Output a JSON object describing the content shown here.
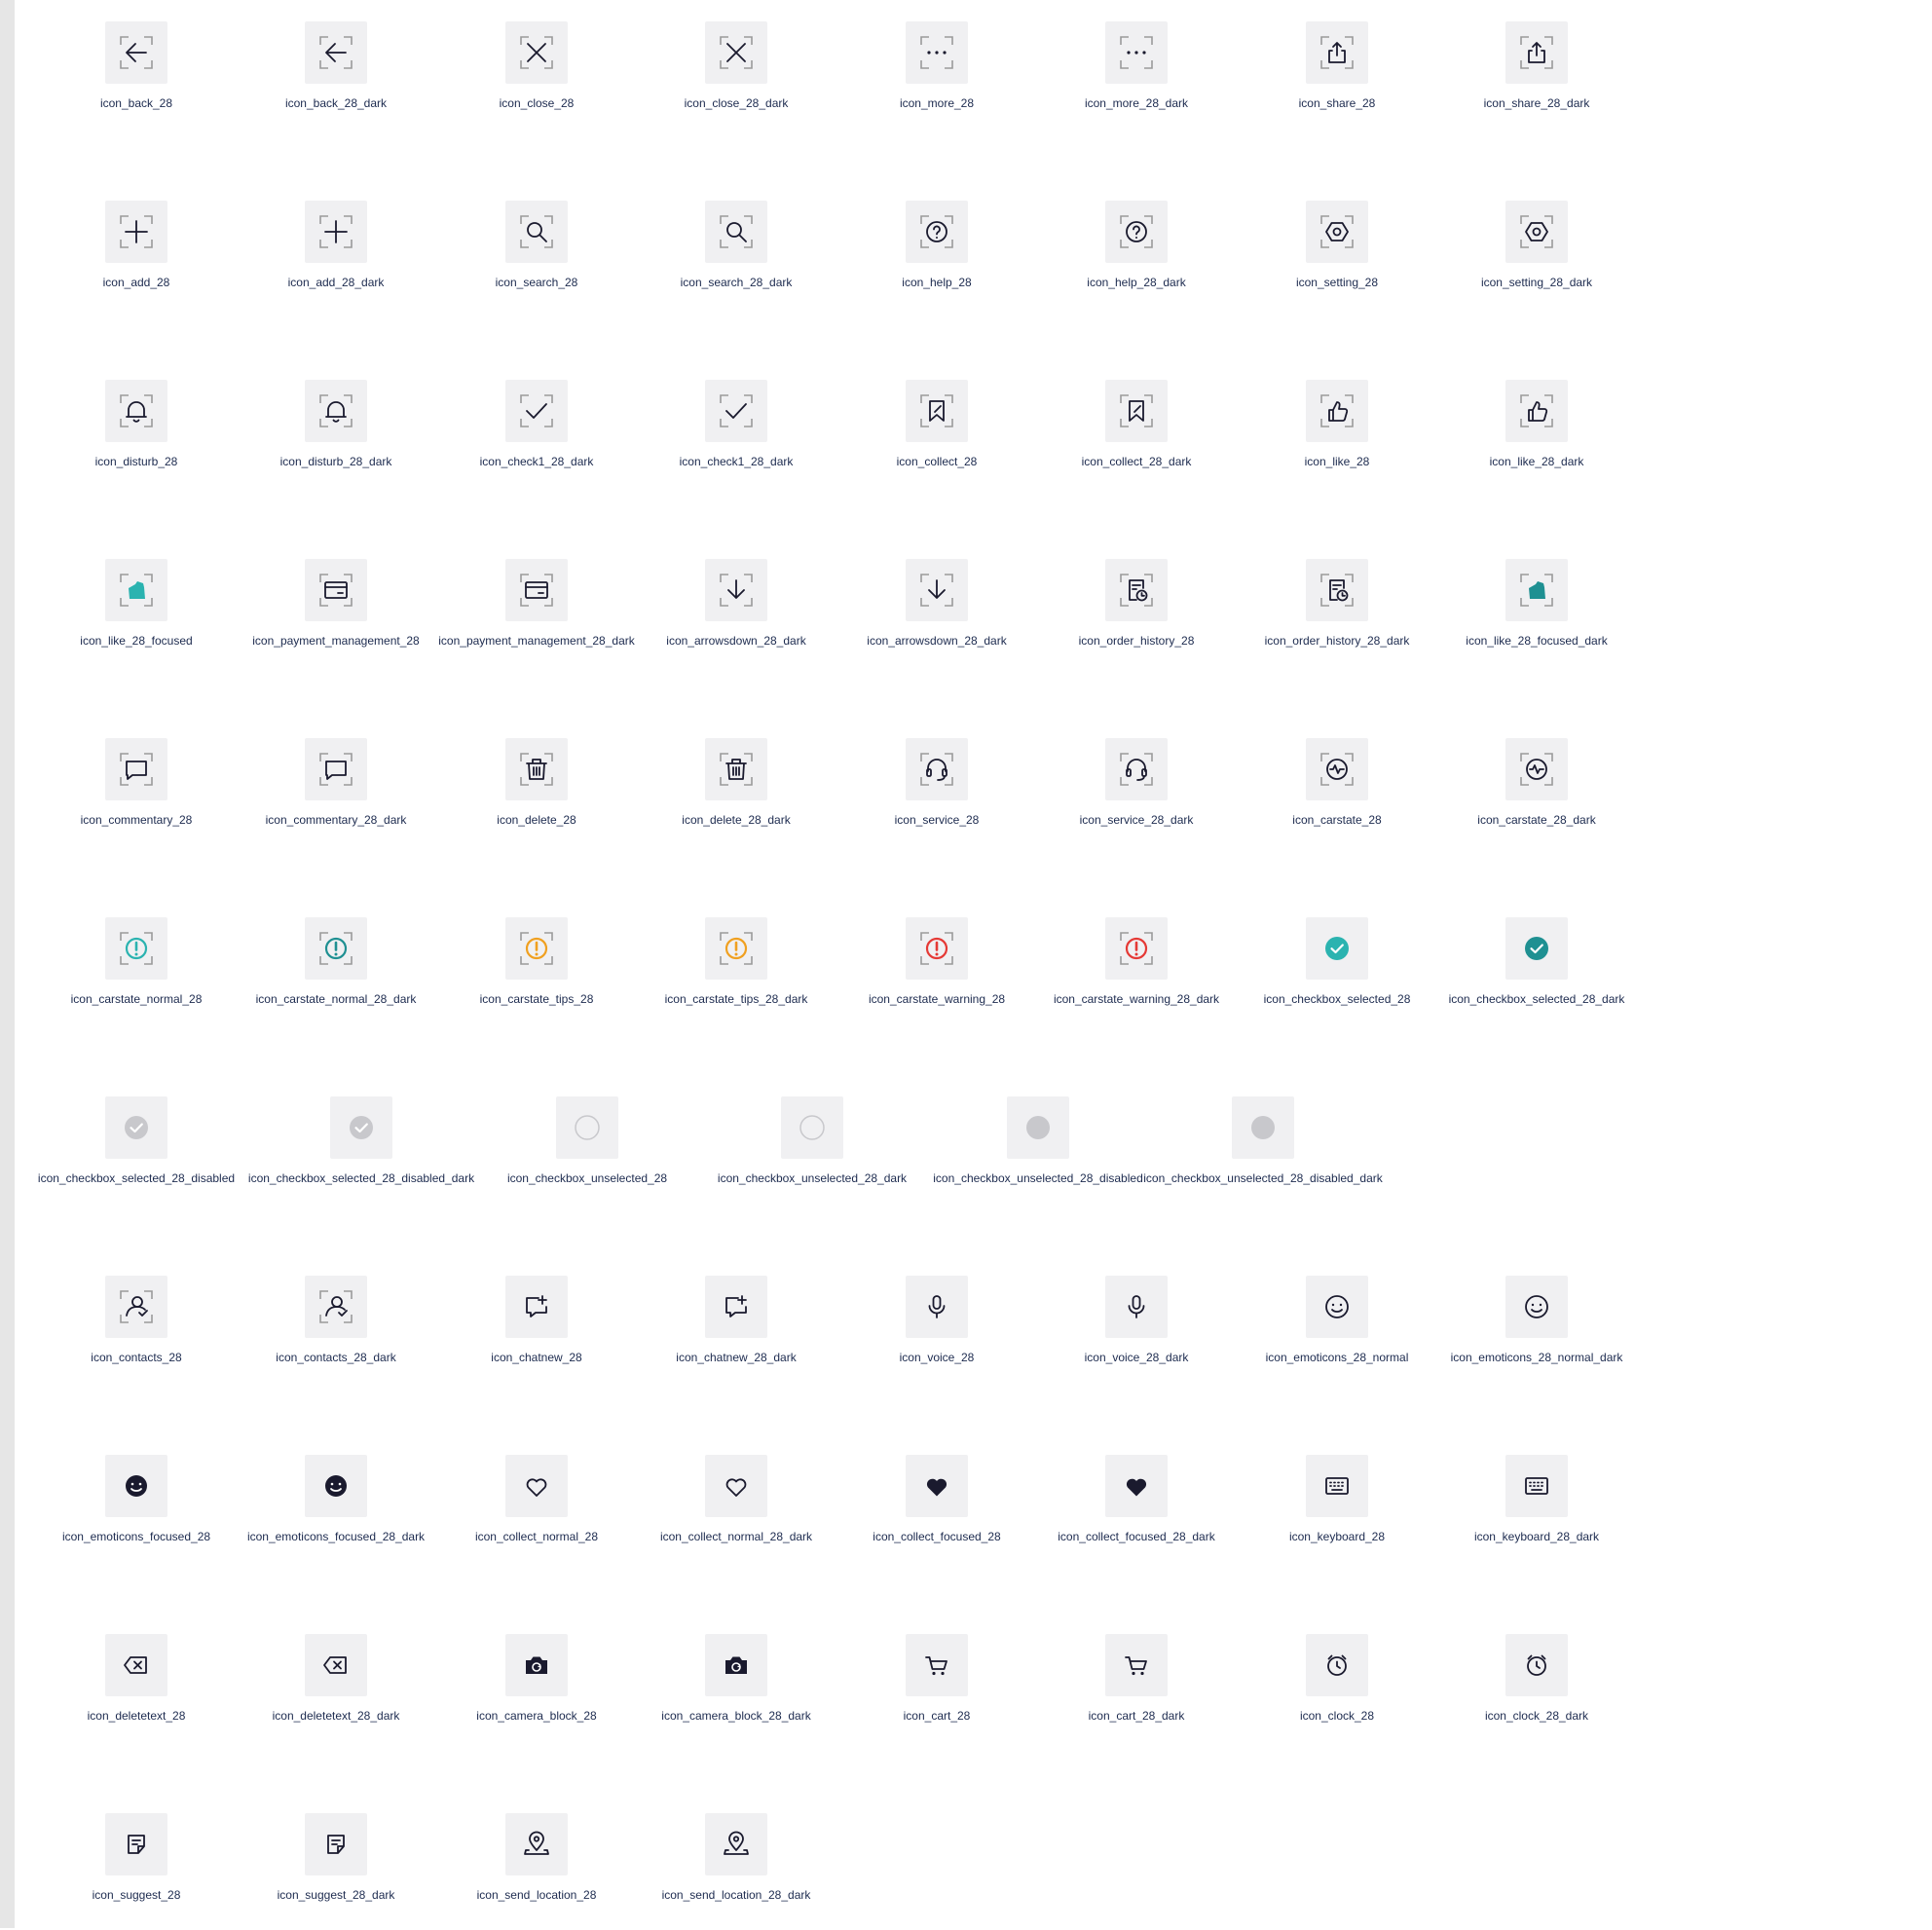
{
  "colors": {
    "tile": "#f0f0f2",
    "corner": "#9a9a9a",
    "icon_dark": "#1a1a2e",
    "icon_faint": "#e6e6ea",
    "teal": "#2bb3b0",
    "teal_dark": "#1f9092",
    "orange": "#f0a020",
    "red": "#e53935",
    "disabled_grey": "#c8c8cc",
    "label": "#1d2b4f"
  },
  "rows": [
    [
      {
        "label": "icon_back_28",
        "icon": "back-icon",
        "g": "back",
        "tone": "dark",
        "frame": true
      },
      {
        "label": "icon_back_28_dark",
        "icon": "back-icon",
        "g": "back",
        "tone": "faint",
        "frame": true
      },
      {
        "label": "icon_close_28",
        "icon": "close-icon",
        "g": "close",
        "tone": "dark",
        "frame": true
      },
      {
        "label": "icon_close_28_dark",
        "icon": "close-icon",
        "g": "close",
        "tone": "faint",
        "frame": true
      },
      {
        "label": "icon_more_28",
        "icon": "more-icon",
        "g": "more",
        "tone": "dark",
        "frame": true
      },
      {
        "label": "icon_more_28_dark",
        "icon": "more-icon",
        "g": "more",
        "tone": "faint",
        "frame": true
      },
      {
        "label": "icon_share_28",
        "icon": "share-icon",
        "g": "share",
        "tone": "dark",
        "frame": true
      },
      {
        "label": "icon_share_28_dark",
        "icon": "share-icon",
        "g": "share",
        "tone": "faint",
        "frame": true
      }
    ],
    [
      {
        "label": "icon_add_28",
        "icon": "add-icon",
        "g": "add",
        "tone": "dark",
        "frame": true
      },
      {
        "label": "icon_add_28_dark",
        "icon": "add-icon",
        "g": "add",
        "tone": "faint",
        "frame": true
      },
      {
        "label": "icon_search_28",
        "icon": "search-icon",
        "g": "search",
        "tone": "dark",
        "frame": true
      },
      {
        "label": "icon_search_28_dark",
        "icon": "search-icon",
        "g": "search",
        "tone": "faint",
        "frame": true
      },
      {
        "label": "icon_help_28",
        "icon": "help-icon",
        "g": "help",
        "tone": "dark",
        "frame": true
      },
      {
        "label": "icon_help_28_dark",
        "icon": "help-icon",
        "g": "help",
        "tone": "faint",
        "frame": true
      },
      {
        "label": "icon_setting_28",
        "icon": "setting-icon",
        "g": "setting",
        "tone": "dark",
        "frame": true
      },
      {
        "label": "icon_setting_28_dark",
        "icon": "setting-icon",
        "g": "setting",
        "tone": "faint",
        "frame": true
      }
    ],
    [
      {
        "label": "icon_disturb_28",
        "icon": "bell-icon",
        "g": "bell",
        "tone": "dark",
        "frame": true
      },
      {
        "label": "icon_disturb_28_dark",
        "icon": "bell-icon",
        "g": "bell",
        "tone": "faint",
        "frame": true
      },
      {
        "label": "icon_check1_28_dark",
        "icon": "check-icon",
        "g": "check",
        "tone": "dark",
        "frame": true
      },
      {
        "label": "icon_check1_28_dark",
        "icon": "check-icon",
        "g": "check",
        "tone": "faint",
        "frame": true
      },
      {
        "label": "icon_collect_28",
        "icon": "bookmark-icon",
        "g": "bookmark",
        "tone": "dark",
        "frame": true
      },
      {
        "label": "icon_collect_28_dark",
        "icon": "bookmark-icon",
        "g": "bookmark",
        "tone": "faint",
        "frame": true
      },
      {
        "label": "icon_like_28",
        "icon": "thumbs-up-icon",
        "g": "like",
        "tone": "dark",
        "frame": true
      },
      {
        "label": "icon_like_28_dark",
        "icon": "thumbs-up-icon",
        "g": "like",
        "tone": "faint",
        "frame": true
      }
    ],
    [
      {
        "label": "icon_like_28_focused",
        "icon": "thumbs-up-filled-icon",
        "g": "likefill",
        "tone": "teal",
        "frame": true
      },
      {
        "label": "icon_payment_management_28",
        "icon": "card-icon",
        "g": "card",
        "tone": "dark",
        "frame": true
      },
      {
        "label": "icon_payment_management_28_dark",
        "icon": "card-icon",
        "g": "card",
        "tone": "faint",
        "frame": true
      },
      {
        "label": "icon_arrowsdown_28_dark",
        "icon": "arrow-down-icon",
        "g": "arrowdown",
        "tone": "dark",
        "frame": true
      },
      {
        "label": "icon_arrowsdown_28_dark",
        "icon": "arrow-down-icon",
        "g": "arrowdown",
        "tone": "faint",
        "frame": true
      },
      {
        "label": "icon_order_history_28",
        "icon": "order-history-icon",
        "g": "order",
        "tone": "dark",
        "frame": true
      },
      {
        "label": "icon_order_history_28_dark",
        "icon": "order-history-icon",
        "g": "order",
        "tone": "faint",
        "frame": true
      },
      {
        "label": "icon_like_28_focused_dark",
        "icon": "thumbs-up-filled-icon",
        "g": "likefill",
        "tone": "teal_dark",
        "frame": true
      }
    ],
    [
      {
        "label": "icon_commentary_28",
        "icon": "comment-icon",
        "g": "comment",
        "tone": "dark",
        "frame": true
      },
      {
        "label": "icon_commentary_28_dark",
        "icon": "comment-icon",
        "g": "comment",
        "tone": "faint",
        "frame": true
      },
      {
        "label": "icon_delete_28",
        "icon": "trash-icon",
        "g": "trash",
        "tone": "dark",
        "frame": true
      },
      {
        "label": "icon_delete_28_dark",
        "icon": "trash-icon",
        "g": "trash",
        "tone": "faint",
        "frame": true
      },
      {
        "label": "icon_service_28",
        "icon": "headset-icon",
        "g": "headset",
        "tone": "dark",
        "frame": true
      },
      {
        "label": "icon_service_28_dark",
        "icon": "headset-icon",
        "g": "headset",
        "tone": "faint",
        "frame": true
      },
      {
        "label": "icon_carstate_28",
        "icon": "car-state-icon",
        "g": "carstate",
        "tone": "dark",
        "frame": true
      },
      {
        "label": "icon_carstate_28_dark",
        "icon": "car-state-icon",
        "g": "carstate",
        "tone": "faint",
        "frame": true
      }
    ],
    [
      {
        "label": "icon_carstate_normal_28",
        "icon": "alert-icon",
        "g": "alert",
        "tone": "teal",
        "frame": true
      },
      {
        "label": "icon_carstate_normal_28_dark",
        "icon": "alert-icon",
        "g": "alert",
        "tone": "teal_dark",
        "frame": true
      },
      {
        "label": "icon_carstate_tips_28",
        "icon": "alert-icon",
        "g": "alert",
        "tone": "orange",
        "frame": true
      },
      {
        "label": "icon_carstate_tips_28_dark",
        "icon": "alert-icon",
        "g": "alert",
        "tone": "orange",
        "frame": true
      },
      {
        "label": "icon_carstate_warning_28",
        "icon": "alert-icon",
        "g": "alert",
        "tone": "red",
        "frame": true
      },
      {
        "label": "icon_carstate_warning_28_dark",
        "icon": "alert-icon",
        "g": "alert",
        "tone": "red",
        "frame": true
      },
      {
        "label": "icon_checkbox_selected_28",
        "icon": "checkbox-checked-icon",
        "g": "cbcheck",
        "tone": "teal",
        "frame": false
      },
      {
        "label": "icon_checkbox_selected_28_dark",
        "icon": "checkbox-checked-icon",
        "g": "cbcheck",
        "tone": "teal_dark",
        "frame": false
      }
    ],
    [
      {
        "label": "icon_checkbox_selected_28_disabled",
        "icon": "checkbox-checked-icon",
        "g": "cbcheck",
        "tone": "disabled_grey",
        "frame": false
      },
      {
        "label": "icon_checkbox_selected_28_disabled_dark",
        "icon": "checkbox-checked-icon",
        "g": "cbcheck",
        "tone": "disabled_grey",
        "frame": false
      },
      {
        "label": "icon_checkbox_unselected_28",
        "icon": "checkbox-empty-icon",
        "g": "cbempty",
        "tone": "disabled_grey",
        "frame": false
      },
      {
        "label": "icon_checkbox_unselected_28_dark",
        "icon": "checkbox-empty-icon",
        "g": "cbempty",
        "tone": "disabled_grey",
        "frame": false
      },
      {
        "label": "icon_checkbox_unselected_28_disabled",
        "icon": "checkbox-disabled-icon",
        "g": "cbdisabled",
        "tone": "disabled_grey",
        "frame": false
      },
      {
        "label": "icon_checkbox_unselected_28_disabled_dark",
        "icon": "checkbox-disabled-icon",
        "g": "cbdisabled",
        "tone": "disabled_grey",
        "frame": false
      }
    ],
    [
      {
        "label": "icon_contacts_28",
        "icon": "contacts-icon",
        "g": "contacts",
        "tone": "dark",
        "frame": true
      },
      {
        "label": "icon_contacts_28_dark",
        "icon": "contacts-icon",
        "g": "contacts",
        "tone": "faint",
        "frame": true
      },
      {
        "label": "icon_chatnew_28",
        "icon": "chat-new-icon",
        "g": "chatnew",
        "tone": "dark",
        "frame": false
      },
      {
        "label": "icon_chatnew_28_dark",
        "icon": "chat-new-icon",
        "g": "chatnew",
        "tone": "faint",
        "frame": false
      },
      {
        "label": "icon_voice_28",
        "icon": "microphone-icon",
        "g": "mic",
        "tone": "dark",
        "frame": false
      },
      {
        "label": "icon_voice_28_dark",
        "icon": "microphone-icon",
        "g": "mic",
        "tone": "faint",
        "frame": false
      },
      {
        "label": "icon_emoticons_28_normal",
        "icon": "smiley-icon",
        "g": "smile",
        "tone": "dark",
        "frame": false
      },
      {
        "label": "icon_emoticons_28_normal_dark",
        "icon": "smiley-icon",
        "g": "smile",
        "tone": "faint",
        "frame": false
      }
    ],
    [
      {
        "label": "icon_emoticons_focused_28",
        "icon": "smiley-filled-icon",
        "g": "smilefill",
        "tone": "dark",
        "frame": false
      },
      {
        "label": "icon_emoticons_focused_28_dark",
        "icon": "smiley-filled-icon",
        "g": "smilefill",
        "tone": "faint",
        "frame": false
      },
      {
        "label": "icon_collect_normal_28",
        "icon": "heart-icon",
        "g": "heart",
        "tone": "dark",
        "frame": false
      },
      {
        "label": "icon_collect_normal_28_dark",
        "icon": "heart-icon",
        "g": "heart",
        "tone": "faint",
        "frame": false
      },
      {
        "label": "icon_collect_focused_28",
        "icon": "heart-filled-icon",
        "g": "heartfill",
        "tone": "dark",
        "frame": false
      },
      {
        "label": "icon_collect_focused_28_dark",
        "icon": "heart-filled-icon",
        "g": "heartfill",
        "tone": "faint",
        "frame": false
      },
      {
        "label": "icon_keyboard_28",
        "icon": "keyboard-icon",
        "g": "keyboard",
        "tone": "dark",
        "frame": false
      },
      {
        "label": "icon_keyboard_28_dark",
        "icon": "keyboard-icon",
        "g": "keyboard",
        "tone": "faint",
        "frame": false
      }
    ],
    [
      {
        "label": "icon_deletetext_28",
        "icon": "backspace-icon",
        "g": "backspace",
        "tone": "dark",
        "frame": false
      },
      {
        "label": "icon_deletetext_28_dark",
        "icon": "backspace-icon",
        "g": "backspace",
        "tone": "faint",
        "frame": false
      },
      {
        "label": "icon_camera_block_28",
        "icon": "camera-icon",
        "g": "camera",
        "tone": "dark",
        "frame": false
      },
      {
        "label": "icon_camera_block_28_dark",
        "icon": "camera-icon",
        "g": "camera",
        "tone": "faint",
        "frame": false
      },
      {
        "label": "icon_cart_28",
        "icon": "cart-icon",
        "g": "cart",
        "tone": "dark",
        "frame": false
      },
      {
        "label": "icon_cart_28_dark",
        "icon": "cart-icon",
        "g": "cart",
        "tone": "faint",
        "frame": false
      },
      {
        "label": "icon_clock_28",
        "icon": "alarm-clock-icon",
        "g": "clock",
        "tone": "dark",
        "frame": false
      },
      {
        "label": "icon_clock_28_dark",
        "icon": "alarm-clock-icon",
        "g": "clock",
        "tone": "faint",
        "frame": false
      }
    ],
    [
      {
        "label": "icon_suggest_28",
        "icon": "note-icon",
        "g": "note",
        "tone": "dark",
        "frame": false
      },
      {
        "label": "icon_suggest_28_dark",
        "icon": "note-icon",
        "g": "note",
        "tone": "faint",
        "frame": false
      },
      {
        "label": "icon_send_location_28",
        "icon": "location-pin-icon",
        "g": "pin",
        "tone": "dark",
        "frame": false
      },
      {
        "label": "icon_send_location_28_dark",
        "icon": "location-pin-icon",
        "g": "pin",
        "tone": "faint",
        "frame": false
      }
    ]
  ]
}
